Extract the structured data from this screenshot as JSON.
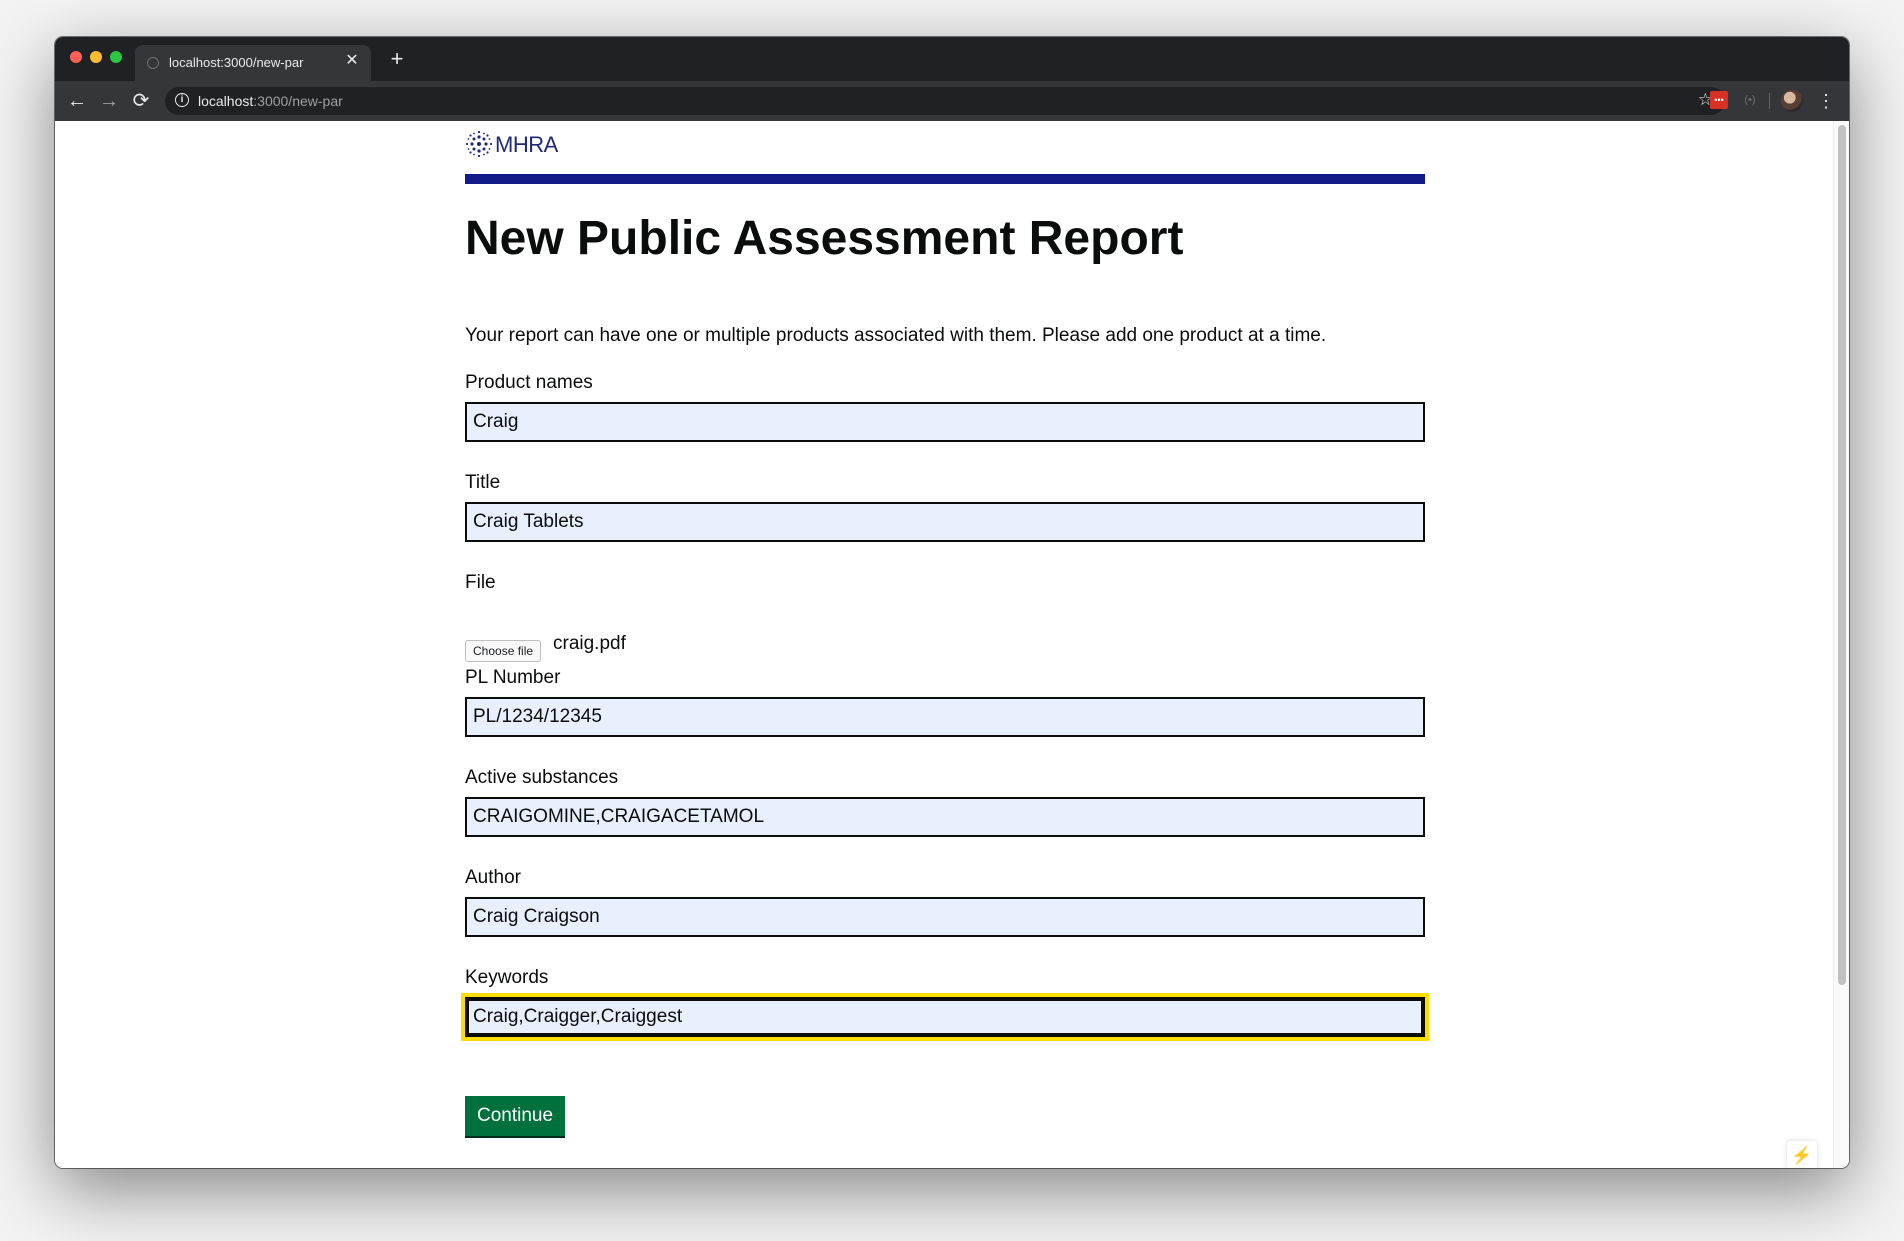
{
  "browser": {
    "tab_title": "localhost:3000/new-par",
    "tab_close": "✕",
    "new_tab": "+",
    "url_host": "localhost",
    "url_rest": ":3000/new-par",
    "back": "←",
    "forward": "→",
    "reload": "⟳",
    "star": "☆",
    "menu": "⋮"
  },
  "header": {
    "logo_text": "MHRA",
    "brand_color": "#111c8a"
  },
  "page": {
    "title": "New Public Assessment Report",
    "intro": "Your report can have one or multiple products associated with them. Please add one product at a time."
  },
  "form": {
    "product_names": {
      "label": "Product names",
      "value": "Craig"
    },
    "title": {
      "label": "Title",
      "value": "Craig Tablets"
    },
    "file": {
      "label": "File",
      "button": "Choose file",
      "filename": "craig.pdf"
    },
    "pl_number": {
      "label": "PL Number",
      "value": "PL/1234/12345"
    },
    "active_substances": {
      "label": "Active substances",
      "value": "CRAIGOMINE,CRAIGACETAMOL"
    },
    "author": {
      "label": "Author",
      "value": "Craig Craigson"
    },
    "keywords": {
      "label": "Keywords",
      "value": "Craig,Craigger,Craiggest"
    },
    "continue_label": "Continue"
  },
  "colors": {
    "input_bg": "#e8f0fe",
    "focus": "#ffdd00",
    "continue_bg": "#00703c"
  },
  "icons": {
    "bolt": "⚡"
  }
}
